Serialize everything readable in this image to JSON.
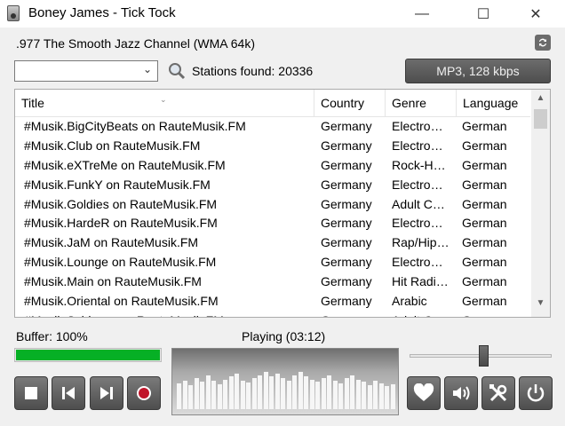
{
  "window": {
    "title": "Boney James - Tick Tock",
    "minimize": "—",
    "maximize": "☐",
    "close": "✕"
  },
  "header": {
    "channel": ".977 The Smooth Jazz Channel (WMA 64k)",
    "refresh_icon": "refresh-icon"
  },
  "search": {
    "combo_value": "",
    "stations_found": "Stations found: 20336",
    "format_button": "MP3, 128 kbps"
  },
  "table": {
    "columns": [
      "Title",
      "Country",
      "Genre",
      "Language"
    ],
    "rows": [
      {
        "title": "#Musik.BigCityBeats on RauteMusik.FM",
        "country": "Germany",
        "genre": "Electro…",
        "language": "German"
      },
      {
        "title": "#Musik.Club on RauteMusik.FM",
        "country": "Germany",
        "genre": "Electro…",
        "language": "German"
      },
      {
        "title": "#Musik.eXTreMe on RauteMusik.FM",
        "country": "Germany",
        "genre": "Rock-H…",
        "language": "German"
      },
      {
        "title": "#Musik.FunkY on RauteMusik.FM",
        "country": "Germany",
        "genre": "Electro…",
        "language": "German"
      },
      {
        "title": "#Musik.Goldies on RauteMusik.FM",
        "country": "Germany",
        "genre": "Adult C…",
        "language": "German"
      },
      {
        "title": "#Musik.HardeR on RauteMusik.FM",
        "country": "Germany",
        "genre": "Electro…",
        "language": "German"
      },
      {
        "title": "#Musik.JaM on RauteMusik.FM",
        "country": "Germany",
        "genre": "Rap/Hip…",
        "language": "German"
      },
      {
        "title": "#Musik.Lounge on RauteMusik.FM",
        "country": "Germany",
        "genre": "Electro…",
        "language": "German"
      },
      {
        "title": "#Musik.Main on RauteMusik.FM",
        "country": "Germany",
        "genre": "Hit Radi…",
        "language": "German"
      },
      {
        "title": "#Musik.Oriental on RauteMusik.FM",
        "country": "Germany",
        "genre": "Arabic",
        "language": "German"
      },
      {
        "title": "#Musik.Schlager on RauteMusik.FM",
        "country": "Germany",
        "genre": "Adult C…",
        "language": "German"
      }
    ]
  },
  "status": {
    "buffer_label": "Buffer: 100%",
    "buffer_fraction": 1.0,
    "playing": "Playing (03:12)",
    "volume_fraction": 0.52
  },
  "visualizer_levels": [
    0.45,
    0.5,
    0.42,
    0.55,
    0.48,
    0.6,
    0.5,
    0.44,
    0.52,
    0.58,
    0.62,
    0.5,
    0.47,
    0.55,
    0.6,
    0.65,
    0.58,
    0.62,
    0.55,
    0.5,
    0.6,
    0.66,
    0.58,
    0.52,
    0.48,
    0.55,
    0.6,
    0.5,
    0.45,
    0.55,
    0.6,
    0.52,
    0.48,
    0.42,
    0.5,
    0.46,
    0.4,
    0.44
  ],
  "controls": {
    "transport": [
      "stop-icon",
      "previous-icon",
      "next-icon",
      "record-icon"
    ],
    "actions": [
      "favorite-heart-icon",
      "volume-icon",
      "settings-tools-icon",
      "power-icon"
    ]
  },
  "colors": {
    "buffer_fill": "#06b025",
    "button_dark": "#5a5a5a"
  }
}
